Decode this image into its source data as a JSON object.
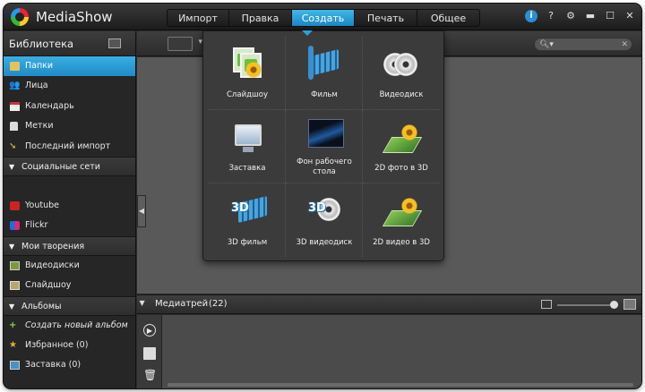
{
  "app": {
    "title": "MediaShow"
  },
  "main_tabs": [
    {
      "label": "Импорт"
    },
    {
      "label": "Правка"
    },
    {
      "label": "Создать",
      "active": true
    },
    {
      "label": "Печать"
    },
    {
      "label": "Общее"
    }
  ],
  "window_controls": {
    "info": "i",
    "help": "?",
    "settings": "⚙",
    "minimize": "▬",
    "maximize": "☐",
    "close": "✕"
  },
  "sidebar": {
    "title": "Библиотека",
    "library_items": [
      {
        "label": "Папки",
        "selected": true,
        "icon": "folder-icon"
      },
      {
        "label": "Лица",
        "icon": "person-icon"
      },
      {
        "label": "Календарь",
        "icon": "calendar-icon"
      },
      {
        "label": "Метки",
        "icon": "tag-icon"
      },
      {
        "label": "Последний импорт",
        "icon": "import-icon"
      }
    ],
    "social": {
      "title": "Социальные сети",
      "items": [
        {
          "label": "Youtube",
          "icon": "youtube-icon"
        },
        {
          "label": "Flickr",
          "icon": "flickr-icon"
        }
      ]
    },
    "creations": {
      "title": "Мои творения",
      "items": [
        {
          "label": "Видеодиски",
          "icon": "videodisc-icon"
        },
        {
          "label": "Слайдшоу",
          "icon": "slideshow-icon"
        }
      ]
    },
    "albums": {
      "title": "Альбомы",
      "items": [
        {
          "label": "Создать новый альбом",
          "icon": "plus-icon"
        },
        {
          "label": "Избранное (0)",
          "icon": "star-icon"
        },
        {
          "label": "Заставка (0)",
          "icon": "screensaver-icon"
        }
      ]
    }
  },
  "search": {
    "placeholder": ""
  },
  "tray": {
    "title": "Медиатрей",
    "count": "(22)"
  },
  "create_menu": {
    "items": [
      {
        "label": "Слайдшоу"
      },
      {
        "label": "Фильм"
      },
      {
        "label": "Видеодиск"
      },
      {
        "label": "Заставка"
      },
      {
        "label": "Фон рабочего стола"
      },
      {
        "label": "2D фото в 3D"
      },
      {
        "label": "3D фильм"
      },
      {
        "label": "3D видеодиск"
      },
      {
        "label": "2D видео в 3D"
      }
    ]
  },
  "colors": {
    "accent": "#2a9fd8",
    "background": "#2b2b2b",
    "content": "#595959"
  }
}
